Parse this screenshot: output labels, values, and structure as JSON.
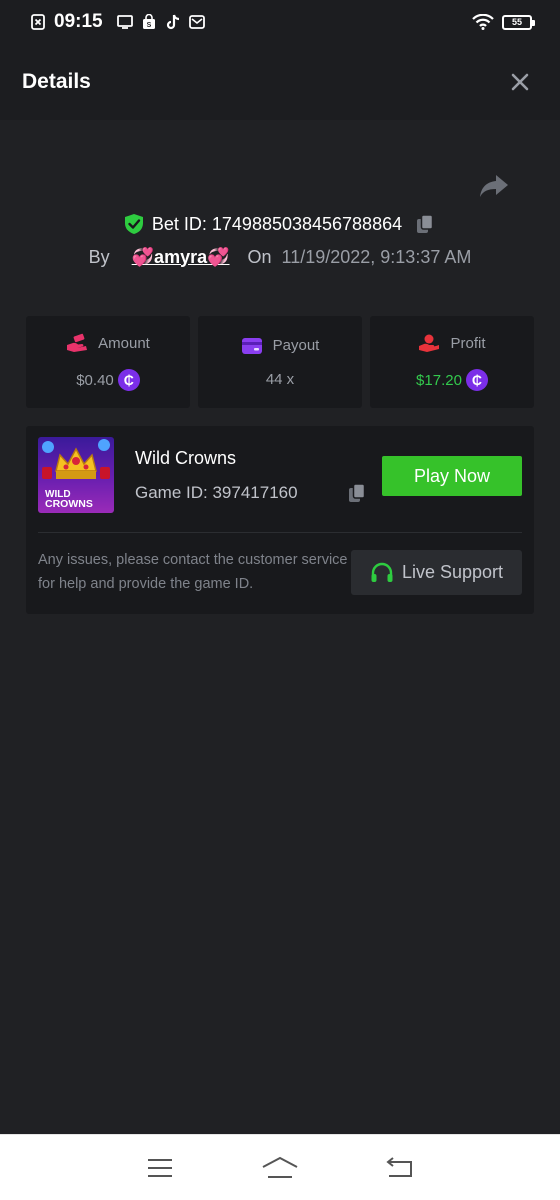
{
  "status_bar": {
    "time": "09:15",
    "battery": "55",
    "left_icons": [
      "close-box-icon",
      "monitor-icon",
      "shopping-bag-icon",
      "tiktok-icon",
      "mail-icon"
    ],
    "right_icons": [
      "wifi-icon",
      "battery-icon"
    ]
  },
  "header": {
    "title": "Details",
    "close_icon": "close-icon"
  },
  "bet": {
    "label": "Bet ID: 1749885038456788864",
    "by_label": "By",
    "username": "💞amyra💞",
    "on_label": "On",
    "date": "11/19/2022, 9:13:37 AM"
  },
  "stats": [
    {
      "label": "Amount",
      "value": "$0.40",
      "icon": "amount-hand-icon",
      "coin": true
    },
    {
      "label": "Payout",
      "value": "44 x",
      "icon": "wallet-card-icon",
      "coin": false
    },
    {
      "label": "Profit",
      "value": "$17.20",
      "icon": "profit-hand-icon",
      "coin": true
    }
  ],
  "coin_symbol": "₵",
  "game": {
    "name": "Wild Crowns",
    "game_id": "Game ID: 397417160",
    "thumb_text_1": "WILD",
    "thumb_text_2": "CROWNS",
    "play_label": "Play Now",
    "help_text": "Any issues, please contact the customer service for help and provide the game ID.",
    "support_label": "Live Support"
  },
  "colors": {
    "background": "#202124",
    "card": "#18191c",
    "accent_green": "#36c22a",
    "profit_green": "#33c94d",
    "coin_purple": "#7b2ee8",
    "shield_green": "#2ecc40"
  },
  "nav": {
    "items": [
      "menu-icon",
      "home-icon",
      "back-icon"
    ]
  }
}
